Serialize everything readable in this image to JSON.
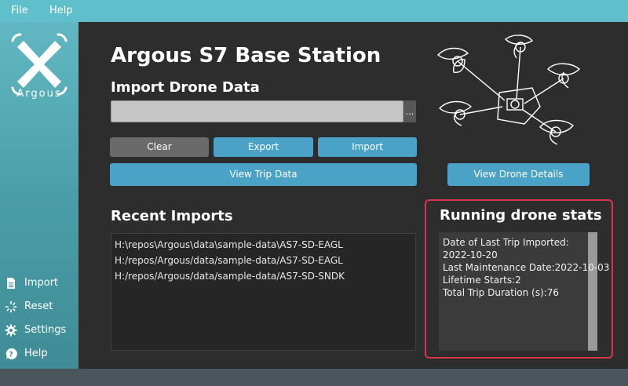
{
  "menu": {
    "file": "File",
    "help": "Help"
  },
  "brand": {
    "name": "Argous"
  },
  "sidebar": {
    "items": [
      {
        "label": "Import",
        "icon": "document-icon"
      },
      {
        "label": "Reset",
        "icon": "reset-spinner-icon"
      },
      {
        "label": "Settings",
        "icon": "gear-icon"
      },
      {
        "label": "Help",
        "icon": "help-icon"
      }
    ]
  },
  "header": {
    "title": "Argous S7 Base Station"
  },
  "import_section": {
    "title": "Import Drone Data",
    "path_value": "",
    "browse_label": "..."
  },
  "buttons": {
    "clear": "Clear",
    "export": "Export",
    "import": "Import",
    "view_trip": "View Trip Data",
    "view_drone": "View Drone Details"
  },
  "recent_imports": {
    "title": "Recent Imports",
    "items": [
      "H:\\repos\\Argous\\data\\sample-data\\AS7-SD-EAGL",
      "H:/repos/Argous/data/sample-data/AS7-SD-EAGL",
      "H:/repos/Argous/data/sample-data/AS7-SD-SNDK"
    ]
  },
  "stats": {
    "title": "Running drone stats",
    "lines": [
      "Date of Last Trip Imported:",
      "2022-10-20",
      "Last Maintenance Date:2022-10-03",
      "Lifetime Starts:2",
      "Total Trip Duration (s):76"
    ]
  },
  "colors": {
    "accent": "#4aa3c7",
    "sidebar": "#4a9ea8",
    "highlight": "#d9344e"
  }
}
